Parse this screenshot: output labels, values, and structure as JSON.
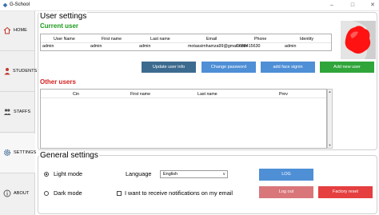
{
  "window": {
    "title": "G-School",
    "minimize": "–",
    "maximize": "□",
    "close": "✕"
  },
  "sidebar": {
    "items": [
      {
        "label": "HOME",
        "icon": "home-icon"
      },
      {
        "label": "STUDENTS",
        "icon": "students-icon"
      },
      {
        "label": "STAFFS",
        "icon": "staffs-icon"
      },
      {
        "label": "SETTINGS",
        "icon": "gear-icon"
      },
      {
        "label": "ABOUT",
        "icon": "info-icon"
      }
    ],
    "active": "SETTINGS"
  },
  "user_settings": {
    "title": "User settings",
    "current_user_heading": "Current user",
    "current_user_columns": [
      "User Name",
      "First name",
      "Last name",
      "Email",
      "Phone",
      "Identity"
    ],
    "current_user_row": [
      "admin",
      "admin",
      "admin",
      "motassimhamza99@gmail.com",
      "0688415630",
      "admin"
    ],
    "buttons": {
      "update": "Update user info",
      "change_password": "Change password",
      "face_signin": "add face signin",
      "add_user": "Add new user"
    },
    "other_users_heading": "Other users",
    "other_users_columns": [
      "Cin",
      "First name",
      "Last name",
      "Prev"
    ]
  },
  "general_settings": {
    "title": "General settings",
    "light_mode": "Light mode",
    "dark_mode": "Dark mode",
    "theme_selected": "Light mode",
    "language_label": "Language",
    "language_value": "English",
    "notifications_label": "I want to receive notifications on my email",
    "notifications_checked": false,
    "buttons": {
      "log": "LOG",
      "logout": "Log out",
      "factory_reset": "Factory reset"
    }
  },
  "colors": {
    "btn_dark_blue": "#3d6b8f",
    "btn_blue": "#4e8fd6",
    "btn_green": "#2fa53a",
    "btn_pink": "#d9767a",
    "btn_red": "#e53f40",
    "heading_green": "#1b9b1b",
    "heading_red": "#d42020"
  }
}
